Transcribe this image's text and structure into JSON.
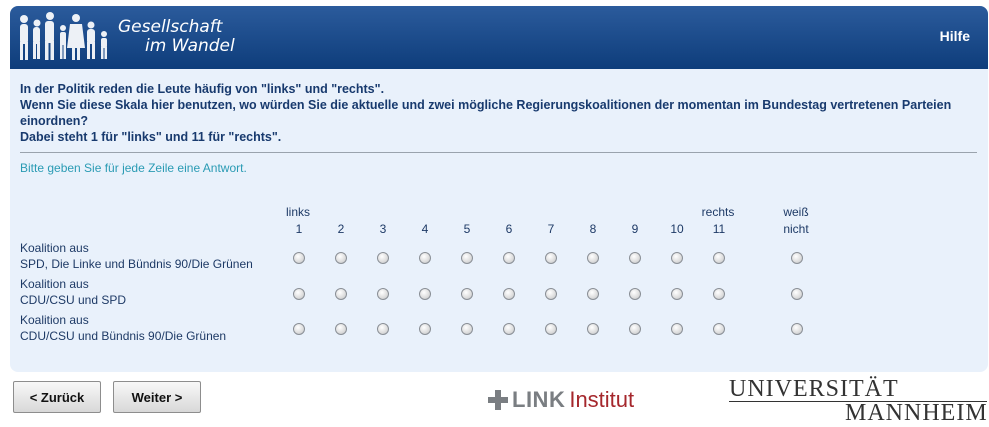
{
  "header": {
    "logo_line1": "Gesellschaft",
    "logo_line2": "im Wandel",
    "help_label": "Hilfe"
  },
  "question": {
    "line1": "In der Politik reden die Leute häufig von \"links\" und \"rechts\".",
    "line2": "Wenn Sie diese Skala hier benutzen, wo würden Sie die aktuelle und zwei mögliche Regierungskoalitionen der momentan im Bundestag vertretenen Parteien einordnen?",
    "line3": "Dabei steht 1 für \"links\" und 11 für \"rechts\"."
  },
  "instruction": "Bitte geben Sie für jede Zeile eine Antwort.",
  "scale": {
    "left_anchor": "links",
    "right_anchor": "rechts",
    "numbers": [
      "1",
      "2",
      "3",
      "4",
      "5",
      "6",
      "7",
      "8",
      "9",
      "10",
      "11"
    ],
    "dont_know_line1": "weiß",
    "dont_know_line2": "nicht"
  },
  "rows": [
    {
      "line1": "Koalition aus",
      "line2": "SPD, Die Linke und Bündnis 90/Die Grünen"
    },
    {
      "line1": "Koalition aus",
      "line2": "CDU/CSU und SPD"
    },
    {
      "line1": "Koalition aus",
      "line2": "CDU/CSU und Bündnis 90/Die Grünen"
    }
  ],
  "nav": {
    "back_label": "< Zurück",
    "next_label": "Weiter >"
  },
  "footer": {
    "link_word": "LINK",
    "link_institut": "Institut",
    "uni_line1": "UNIVERSITÄT",
    "uni_line2": "MANNHEIM"
  }
}
